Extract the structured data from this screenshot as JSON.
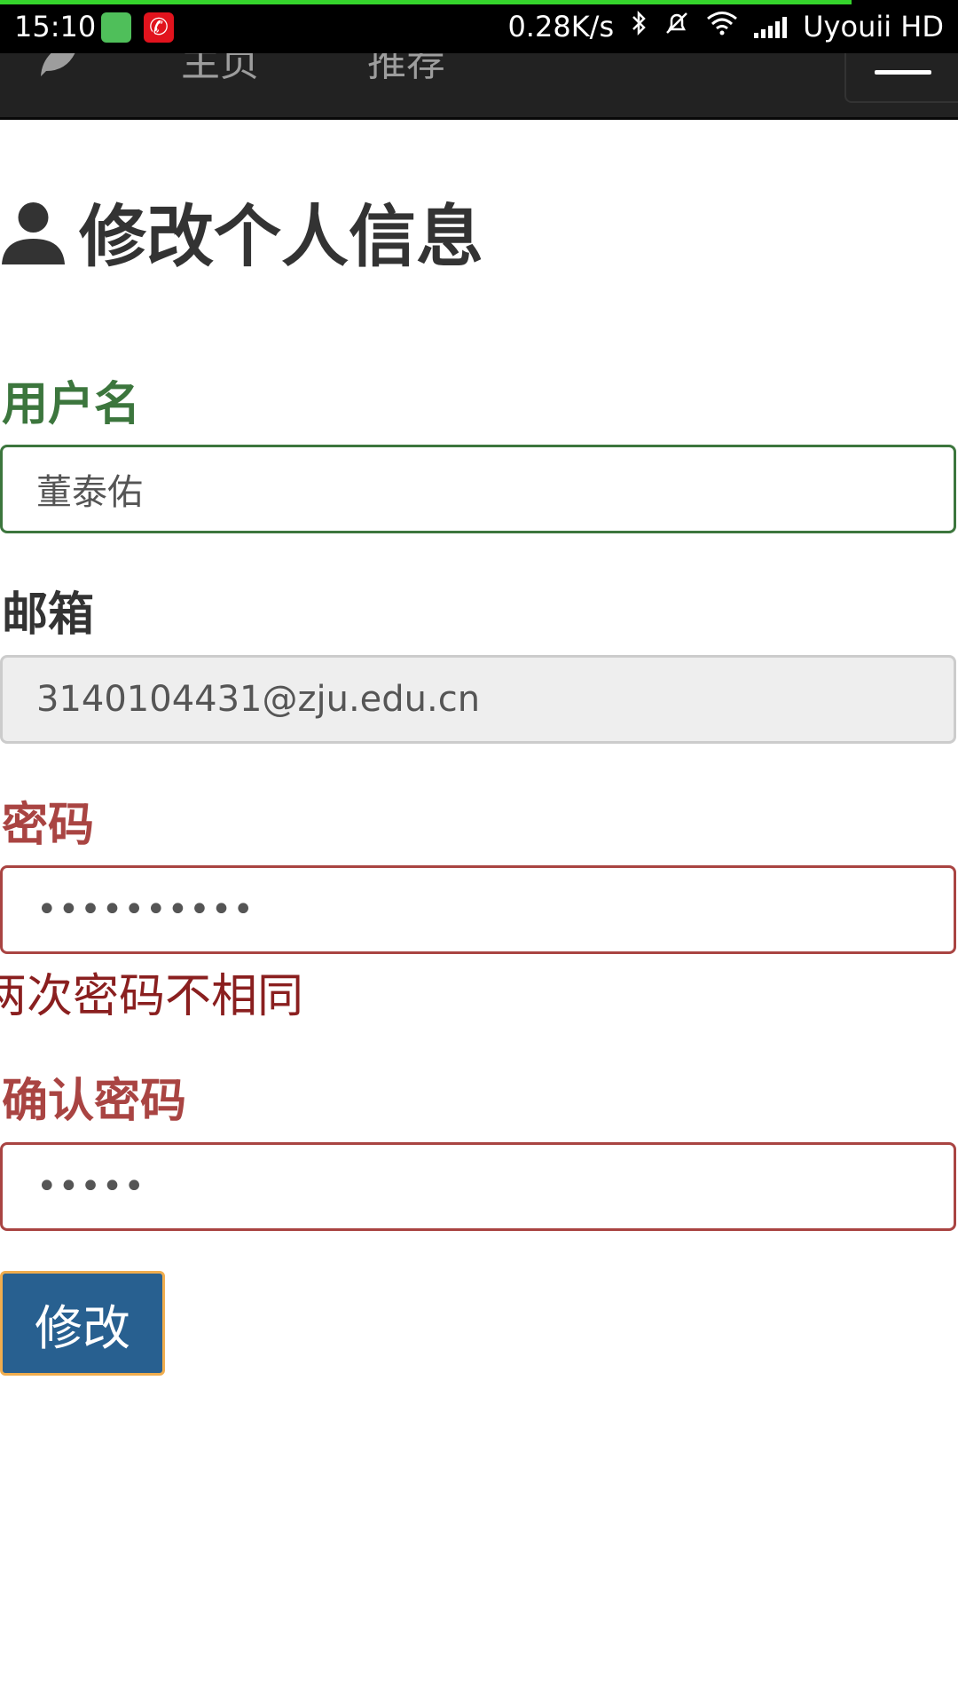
{
  "status_bar": {
    "time": "15:10",
    "net_speed": "0.28K/s",
    "carrier": "Uyouii HD",
    "netease_glyph": "✆",
    "icons": [
      "android-icon",
      "netease-music-icon",
      "bluetooth-icon",
      "mute-icon",
      "wifi-icon",
      "signal-icon"
    ]
  },
  "navbar": {
    "links": [
      "主页",
      "推荐"
    ]
  },
  "page": {
    "title": "修改个人信息"
  },
  "form": {
    "username_label": "用户名",
    "username_value": "董泰佑",
    "email_label": "邮箱",
    "email_value": "3140104431@zju.edu.cn",
    "password_label": "密码",
    "password_mask": "••••••••••",
    "password_error": "两次密码不相同",
    "confirm_label": "确认密码",
    "confirm_mask": "•••••",
    "submit_label": "修改"
  },
  "colors": {
    "success": "#3c763d",
    "error": "#a94442",
    "primary": "#286090",
    "navbar": "#222222"
  }
}
